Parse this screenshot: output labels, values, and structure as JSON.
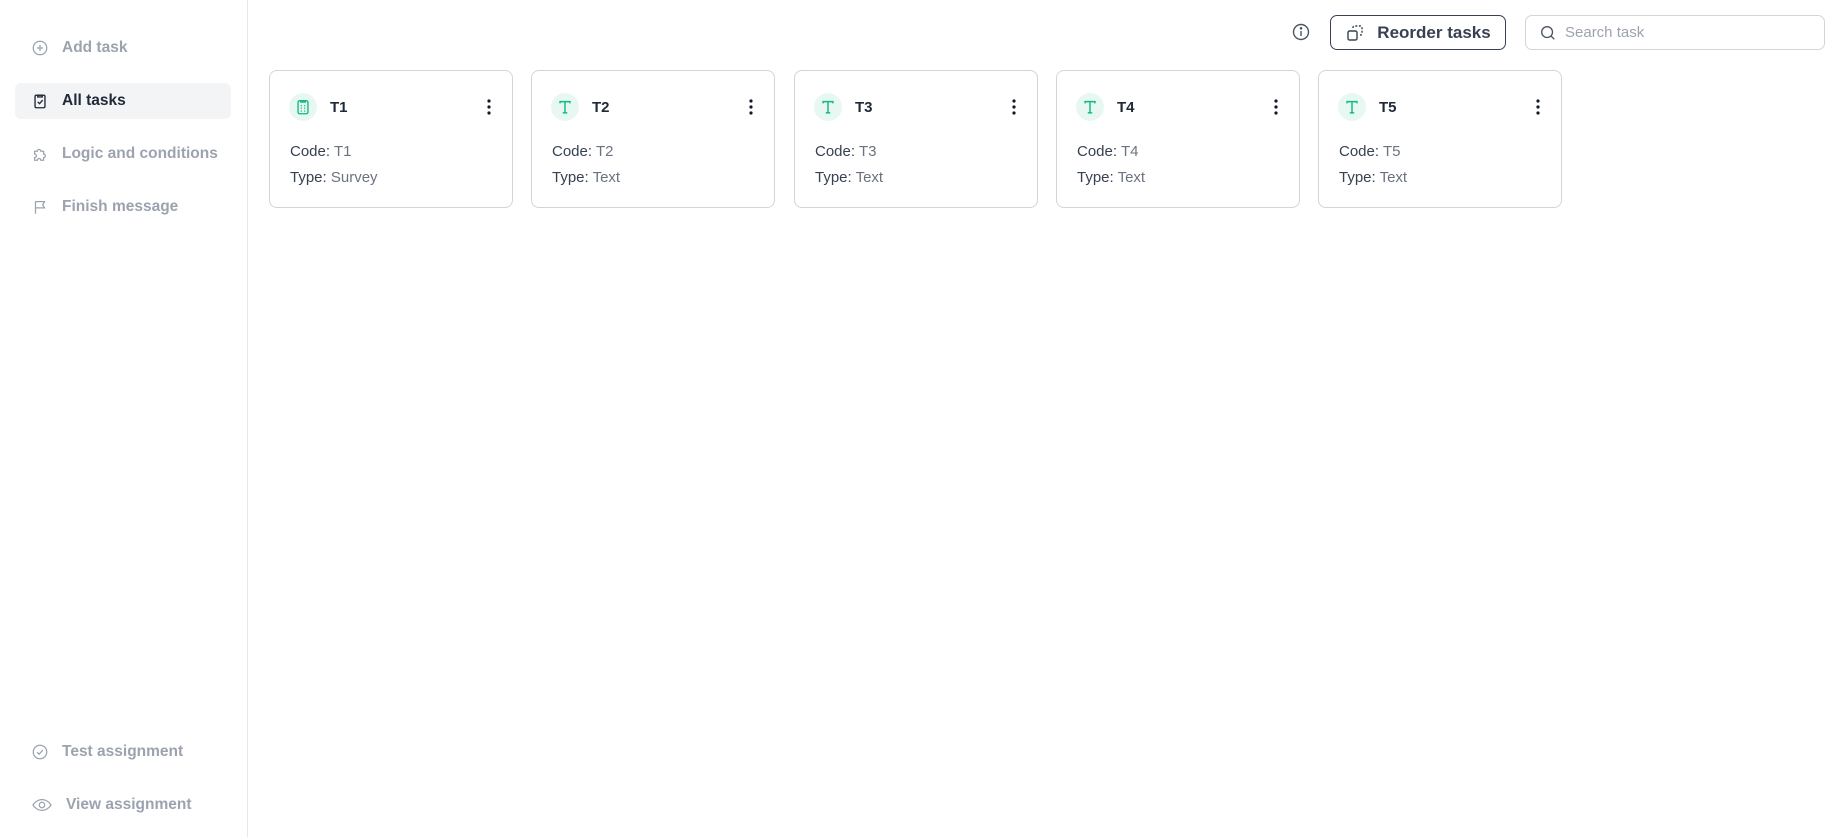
{
  "sidebar": {
    "top_items": [
      {
        "label": "Add task",
        "icon": "plus-circle-icon"
      },
      {
        "label": "All tasks",
        "icon": "clipboard-check-icon",
        "active": true
      },
      {
        "label": "Logic and conditions",
        "icon": "puzzle-icon"
      },
      {
        "label": "Finish message",
        "icon": "flag-icon"
      }
    ],
    "bottom_items": [
      {
        "label": "Test assignment",
        "icon": "check-circle-icon"
      },
      {
        "label": "View assignment",
        "icon": "eye-icon"
      }
    ]
  },
  "toolbar": {
    "info_icon": "info-icon",
    "reorder_label": "Reorder tasks",
    "reorder_icon": "reorder-icon",
    "search_placeholder": "Search task",
    "search_value": ""
  },
  "task_labels": {
    "code": "Code:",
    "type": "Type:"
  },
  "tasks": [
    {
      "title": "T1",
      "code": "T1",
      "type": "Survey",
      "icon": "survey-icon"
    },
    {
      "title": "T2",
      "code": "T2",
      "type": "Text",
      "icon": "text-icon"
    },
    {
      "title": "T3",
      "code": "T3",
      "type": "Text",
      "icon": "text-icon"
    },
    {
      "title": "T4",
      "code": "T4",
      "type": "Text",
      "icon": "text-icon"
    },
    {
      "title": "T5",
      "code": "T5",
      "type": "Text",
      "icon": "text-icon"
    }
  ],
  "colors": {
    "accent": "#10b981",
    "badge_bg": "#e7f8f2",
    "active_bg": "#f3f4f6",
    "muted": "#9ca3af"
  }
}
